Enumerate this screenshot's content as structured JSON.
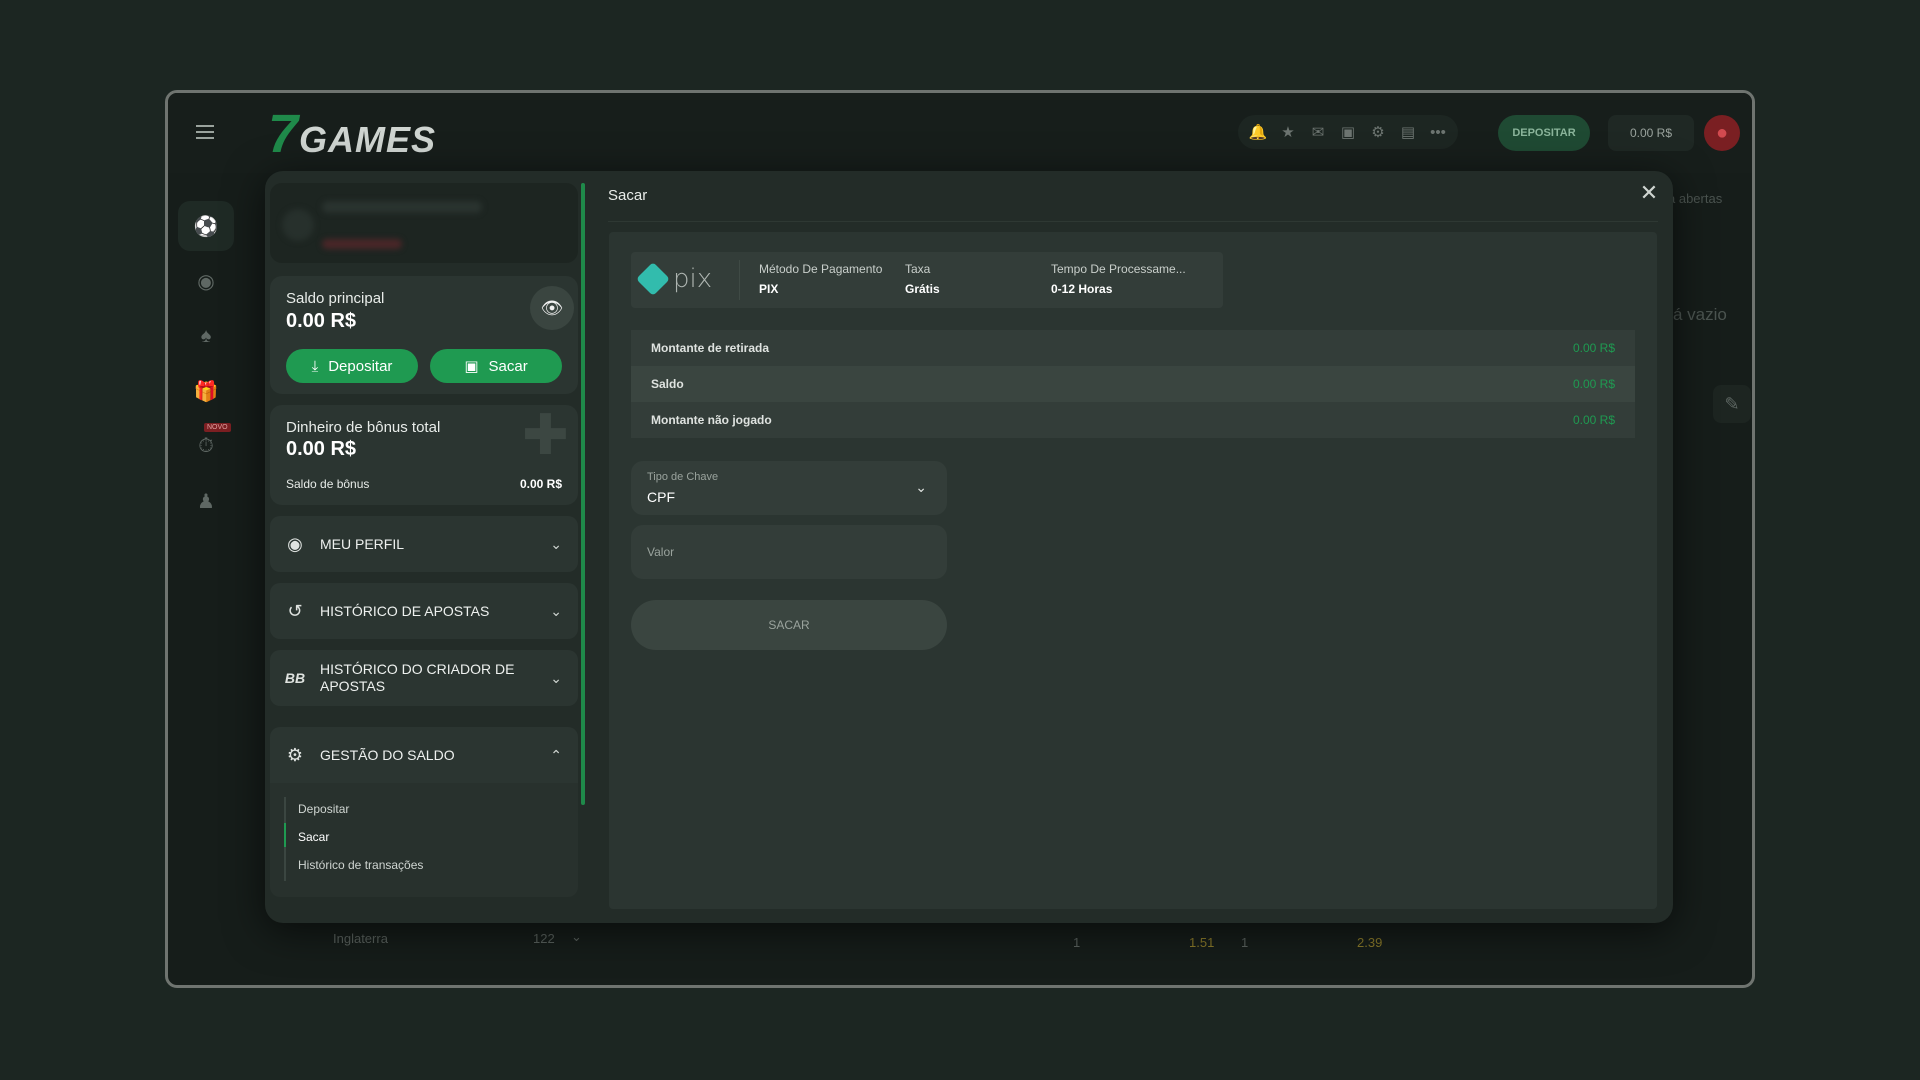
{
  "topbar": {
    "logo": "7GAMES",
    "deposit_label": "DEPOSITAR",
    "balance": "0.00 R$",
    "icons": [
      "bell-icon",
      "star-icon",
      "mail-icon",
      "gift-icon",
      "gear-icon",
      "chat-icon",
      "more-icon"
    ]
  },
  "rail": {
    "items": [
      "soccer-icon",
      "basketball-icon",
      "cards-icon",
      "gift-icon",
      "stopwatch-icon",
      "user-icon"
    ],
    "novo_badge": "NOVO"
  },
  "background": {
    "tag_text": "a abertas",
    "empty_text": "á vazio",
    "list_item_name": "Inglaterra",
    "list_item_count": "122",
    "odds": [
      "1",
      "1.51",
      "1",
      "2.39"
    ]
  },
  "sidebar": {
    "balance_card": {
      "label": "Saldo principal",
      "value": "0.00 R$",
      "deposit_button": "Depositar",
      "withdraw_button": "Sacar"
    },
    "bonus_card": {
      "label": "Dinheiro de bônus total",
      "value": "0.00 R$",
      "sub_label": "Saldo de bônus",
      "sub_value": "0.00 R$"
    },
    "menu": {
      "profile": "MEU PERFIL",
      "bet_history": "HISTÓRICO DE APOSTAS",
      "creator_history": "HISTÓRICO DO CRIADOR DE APOSTAS",
      "balance_management": "GESTÃO DO SALDO"
    },
    "submenu": {
      "deposit": "Depositar",
      "withdraw": "Sacar",
      "transactions": "Histórico de transações"
    }
  },
  "main": {
    "title": "Sacar",
    "payment_method": {
      "logo_text": "pix",
      "method_header": "Método De Pagamento",
      "method_value": "PIX",
      "fee_header": "Taxa",
      "fee_value": "Grátis",
      "time_header": "Tempo De Processame...",
      "time_value": "0-12 Horas"
    },
    "rows": [
      {
        "label": "Montante de retirada",
        "value": "0.00 R$"
      },
      {
        "label": "Saldo",
        "value": "0.00 R$"
      },
      {
        "label": "Montante não jogado",
        "value": "0.00 R$"
      }
    ],
    "key_type": {
      "label": "Tipo de Chave",
      "value": "CPF"
    },
    "amount_placeholder": "Valor",
    "submit_label": "SACAR"
  },
  "colors": {
    "accent_green": "#1f9a51",
    "background": "#1c2622",
    "panel": "#2b3531"
  }
}
